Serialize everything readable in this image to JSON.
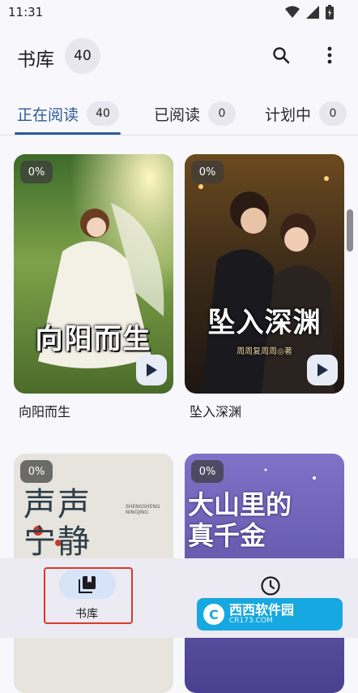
{
  "status_bar": {
    "time": "11:31"
  },
  "app_bar": {
    "title": "书库",
    "count": "40",
    "search_icon": "search-icon",
    "more_icon": "more-vert-icon"
  },
  "tabs": [
    {
      "label": "正在阅读",
      "count": "40",
      "active": true
    },
    {
      "label": "已阅读",
      "count": "0",
      "active": false
    },
    {
      "label": "计划中",
      "count": "0",
      "active": false
    }
  ],
  "books": [
    {
      "title": "向阳而生",
      "progress": "0%",
      "cover_text": "向阳而生"
    },
    {
      "title": "坠入深渊",
      "progress": "0%",
      "cover_text": "坠入深渊",
      "cover_author": "周周复周周◎著"
    },
    {
      "progress": "0%",
      "cover_text": "声声宁静",
      "cover_subtext": "SHENGSHENG NINGJING"
    },
    {
      "progress": "0%",
      "cover_text": "大山里的真千金"
    }
  ],
  "bottom_nav": {
    "library_label": "书库",
    "library_icon": "library-books-icon",
    "history_icon": "history-icon"
  },
  "watermark": {
    "logo": "C",
    "main": "西西软件园",
    "sub": "CR173.COM"
  },
  "colors": {
    "accent": "#2d5b95",
    "background": "#f8f7fc",
    "nav_pill": "#d6e3f8",
    "highlight": "#d93a2b"
  }
}
